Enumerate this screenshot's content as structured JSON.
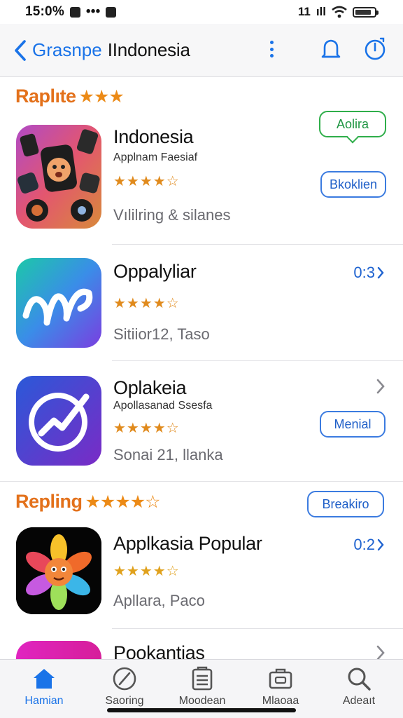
{
  "status": {
    "time": "15:0%",
    "dots": "•••",
    "carrier": "11",
    "signal_bars": "ıll"
  },
  "nav": {
    "back_label": "Grasnpe",
    "title": "IIndonesia"
  },
  "sections": [
    {
      "title": "Raplıte",
      "stars": "★★★"
    },
    {
      "title": "Repling",
      "stars": "★★★★☆",
      "button": "Breakiro"
    }
  ],
  "apps": [
    {
      "name": "Indonesia",
      "subtitle": "Applnam Faesiaf",
      "rating_stars": "★★★★☆",
      "meta": "Vılilring & silanes",
      "button_primary": "Aolira",
      "button_secondary": "Bkoklien"
    },
    {
      "name": "Oppalyliar",
      "rating_stars": "★★★★☆",
      "meta": "Sitiior12, Taso",
      "duration": "0:3"
    },
    {
      "name": "Oplakeia",
      "subtitle": "Apollasanad Ssesfa",
      "rating_stars": "★★★★☆",
      "meta": "Sonai 21, llanka",
      "button": "Menial"
    },
    {
      "name": "Applkasia Popular",
      "rating_stars": "★★★★☆",
      "meta": "Apllara, Paco",
      "duration": "0:2"
    },
    {
      "name": "Pookantias"
    }
  ],
  "tabs": [
    {
      "label": "Hamian",
      "icon": "home-icon",
      "active": true
    },
    {
      "label": "Saoring",
      "icon": "compass-icon",
      "active": false
    },
    {
      "label": "Moodean",
      "icon": "document-icon",
      "active": false
    },
    {
      "label": "Mlaoaa",
      "icon": "briefcase-icon",
      "active": false
    },
    {
      "label": "Adeaıt",
      "icon": "search-icon",
      "active": false
    }
  ],
  "colors": {
    "accent": "#1a73e8",
    "section": "#e3711b",
    "star": "#e08a1c",
    "green": "#2fae4a"
  }
}
